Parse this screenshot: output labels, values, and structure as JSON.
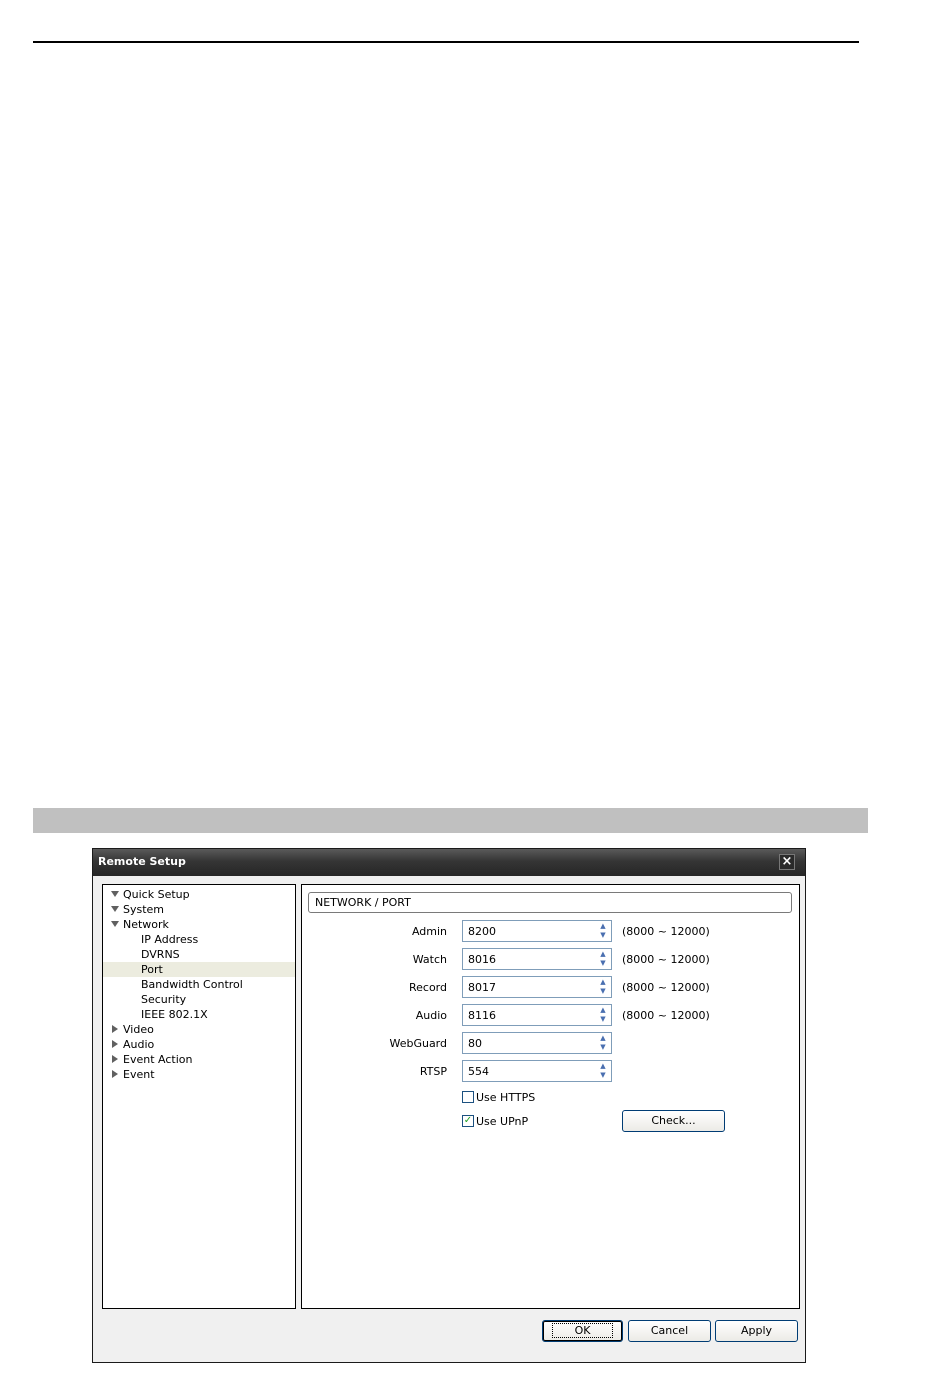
{
  "window": {
    "title": "Remote Setup",
    "close_glyph": "×"
  },
  "tree": {
    "items": [
      {
        "label": "Quick Setup",
        "arrow": "down",
        "level": 0
      },
      {
        "label": "System",
        "arrow": "down",
        "level": 0
      },
      {
        "label": "Network",
        "arrow": "down",
        "level": 0
      },
      {
        "label": "IP Address",
        "arrow": "",
        "level": 1
      },
      {
        "label": "DVRNS",
        "arrow": "",
        "level": 1
      },
      {
        "label": "Port",
        "arrow": "",
        "level": 1,
        "selected": true
      },
      {
        "label": "Bandwidth Control",
        "arrow": "",
        "level": 1
      },
      {
        "label": "Security",
        "arrow": "",
        "level": 1
      },
      {
        "label": "IEEE 802.1X",
        "arrow": "",
        "level": 1
      },
      {
        "label": "Video",
        "arrow": "right",
        "level": 0
      },
      {
        "label": "Audio",
        "arrow": "right",
        "level": 0
      },
      {
        "label": "Event Action",
        "arrow": "right",
        "level": 0
      },
      {
        "label": "Event",
        "arrow": "right",
        "level": 0
      }
    ]
  },
  "panel": {
    "header": "NETWORK / PORT",
    "fields": [
      {
        "label": "Admin",
        "value": "8200",
        "range": "(8000 ~ 12000)"
      },
      {
        "label": "Watch",
        "value": "8016",
        "range": "(8000 ~ 12000)"
      },
      {
        "label": "Record",
        "value": "8017",
        "range": "(8000 ~ 12000)"
      },
      {
        "label": "Audio",
        "value": "8116",
        "range": "(8000 ~ 12000)"
      },
      {
        "label": "WebGuard",
        "value": "80",
        "range": ""
      },
      {
        "label": "RTSP",
        "value": "554",
        "range": ""
      }
    ],
    "spin_up_glyph": "▲",
    "spin_down_glyph": "▼",
    "use_https": {
      "label": "Use HTTPS",
      "checked": false
    },
    "use_upnp": {
      "label": "Use UPnP",
      "checked": true
    },
    "check_glyph": "✓",
    "check_button": "Check..."
  },
  "footer": {
    "ok": "OK",
    "cancel": "Cancel",
    "apply": "Apply"
  },
  "colors": {
    "titlebar": "#2f2f2f",
    "selection": "#ececdf",
    "check": "#21a121"
  }
}
